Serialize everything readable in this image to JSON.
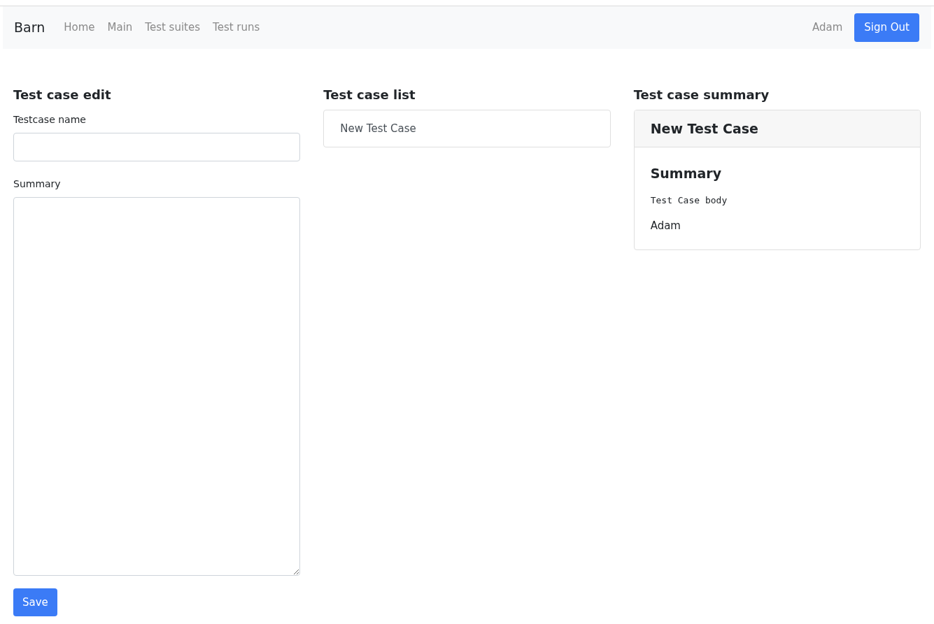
{
  "navbar": {
    "brand": "Barn",
    "links": [
      "Home",
      "Main",
      "Test suites",
      "Test runs"
    ],
    "user": "Adam",
    "sign_out": "Sign Out"
  },
  "edit": {
    "heading": "Test case edit",
    "name_label": "Testcase name",
    "summary_label": "Summary",
    "save": "Save"
  },
  "list": {
    "heading": "Test case list",
    "items": [
      {
        "name": "New Test Case"
      }
    ]
  },
  "summary": {
    "heading": "Test case summary",
    "card_title": "New Test Case",
    "section_title": "Summary",
    "body": "Test Case body",
    "author": "Adam"
  }
}
